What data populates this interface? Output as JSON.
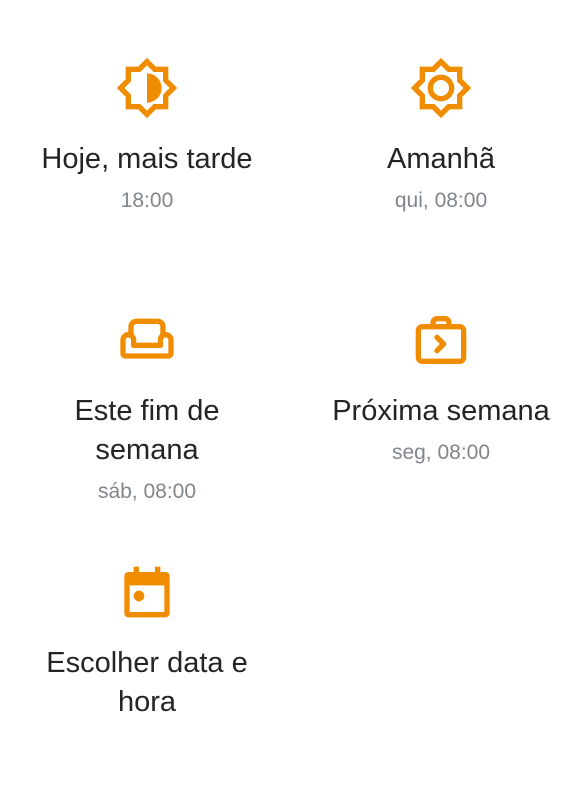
{
  "accent_color": "#F08C00",
  "options": [
    {
      "icon": "brightness-half-icon",
      "label": "Hoje, mais tarde",
      "sub": "18:00"
    },
    {
      "icon": "brightness-icon",
      "label": "Amanhã",
      "sub": "qui, 08:00"
    },
    {
      "icon": "weekend-couch-icon",
      "label": "Este fim de semana",
      "sub": "sáb, 08:00"
    },
    {
      "icon": "next-week-briefcase-icon",
      "label": "Próxima semana",
      "sub": "seg, 08:00"
    },
    {
      "icon": "calendar-icon",
      "label": "Escolher data e hora",
      "sub": ""
    }
  ]
}
